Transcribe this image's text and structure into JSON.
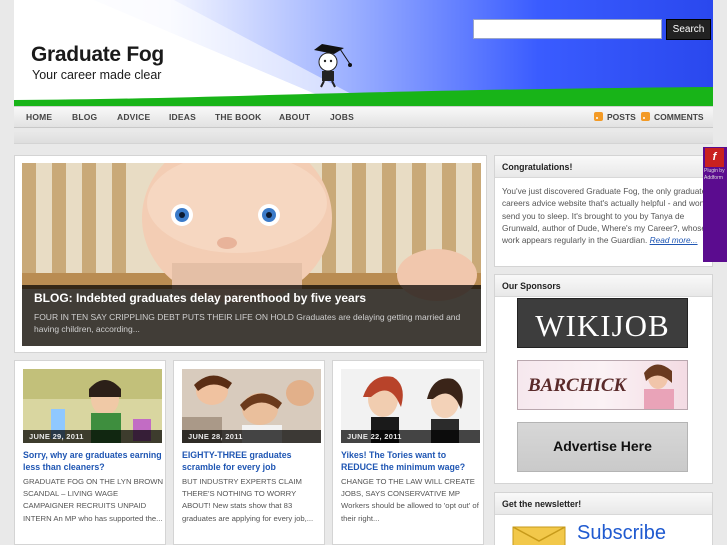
{
  "header": {
    "site_title": "Graduate Fog",
    "tagline": "Your career made clear",
    "search_placeholder": "",
    "search_button": "Search"
  },
  "nav": {
    "items": [
      "HOME",
      "BLOG",
      "ADVICE",
      "IDEAS",
      "THE BOOK",
      "ABOUT",
      "JOBS"
    ],
    "feeds": [
      "POSTS",
      "COMMENTS"
    ]
  },
  "featured": {
    "title": "BLOG: Indebted graduates delay parenthood by five years",
    "excerpt": "FOUR IN TEN SAY CRIPPLING DEBT PUTS THEIR LIFE ON HOLD Graduates are delaying getting married and having children, according..."
  },
  "posts": [
    {
      "date": "JUNE 29, 2011",
      "title": "Sorry, why are graduates earning less than cleaners?",
      "excerpt": "GRADUATE FOG ON THE LYN BROWN SCANDAL – LIVING WAGE CAMPAIGNER RECRUITS UNPAID INTERN An MP who has supported the..."
    },
    {
      "date": "JUNE 28, 2011",
      "title": "EIGHTY-THREE graduates scramble for every job",
      "excerpt": "BUT INDUSTRY EXPERTS CLAIM THERE'S NOTHING TO WORRY ABOUT! New stats show that 83 graduates are applying for every job,..."
    },
    {
      "date": "JUNE 22, 2011",
      "title": "Yikes! The Tories want to REDUCE the minimum wage?",
      "excerpt": "CHANGE TO THE LAW WILL CREATE JOBS, SAYS CONSERVATIVE MP Workers should be allowed to 'opt out' of their right..."
    }
  ],
  "sidebar": {
    "congrats_title": "Congratulations!",
    "congrats_text": "You've just discovered Graduate Fog, the only graduate careers advice website that's actually helpful - and won't send you to sleep. It's brought to you by Tanya de Grunwald, author of Dude, Where's my Career?, whose work appears regularly in the Guardian.",
    "read_more": "Read more...",
    "sponsors_title": "Our Sponsors",
    "sponsor_wikijob": "WIKIJOB",
    "sponsor_barchick": "BARCHICK",
    "advertise": "Advertise Here",
    "newsletter_title": "Get the newsletter!",
    "subscribe": "Subscribe"
  },
  "flash_plugin": {
    "icon_letter": "f",
    "text": "Plugin by Addform"
  },
  "colors": {
    "link": "#1f56b3",
    "header_blue": "#2a48ee",
    "grass_green": "#18b418",
    "rss": "#f39a25"
  }
}
